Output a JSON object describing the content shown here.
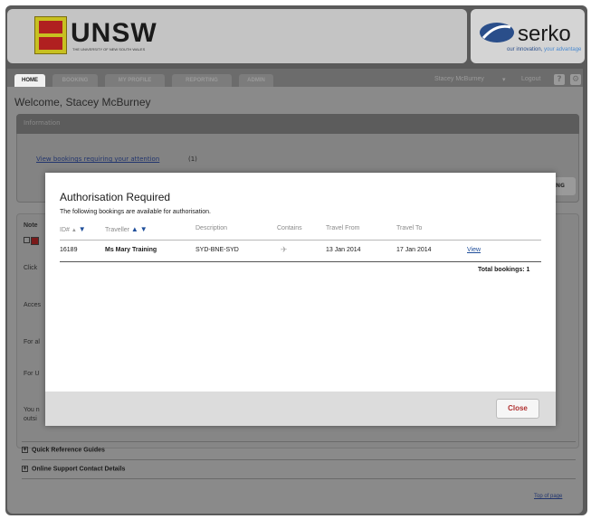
{
  "header": {
    "logo_text": "UNSW",
    "logo_subtitle": "THE UNIVERSITY OF NEW SOUTH WALES",
    "partner_logo": "serko",
    "partner_tagline_a": "our innovation, ",
    "partner_tagline_b": "your advantage"
  },
  "nav": {
    "tabs": [
      {
        "label": "HOME"
      },
      {
        "label": "BOOKING"
      },
      {
        "label": "MY PROFILE"
      },
      {
        "label": "REPORTING"
      },
      {
        "label": "ADMIN"
      }
    ],
    "user_name": "Stacey McBurney",
    "dropdown": "▾",
    "logout": "Logout",
    "help_icon": "?",
    "settings_icon": "gear-icon"
  },
  "page": {
    "welcome": "Welcome, Stacey McBurney",
    "info_heading": "Information",
    "info_link": "View bookings requiring your attention",
    "info_count": "(1)",
    "peek_button": "NG",
    "notes_label": "Note",
    "side_texts": [
      "Click",
      "Acces",
      "For al",
      "For U",
      "You n",
      "outsi"
    ],
    "accordion": [
      {
        "label": "Quick Reference Guides"
      },
      {
        "label": "Online Support Contact Details"
      }
    ],
    "top_link": "Top of page"
  },
  "modal": {
    "title": "Authorisation Required",
    "subtitle": "The following bookings are available for authorisation.",
    "columns": {
      "id": "ID#",
      "traveller": "Traveller",
      "description": "Description",
      "contains": "Contains",
      "travel_from": "Travel From",
      "travel_to": "Travel To"
    },
    "row": {
      "id": "16189",
      "traveller": "Ms Mary Training",
      "description": "SYD-BNE-SYD",
      "contains_icon": "plane-icon",
      "travel_from": "13 Jan 2014",
      "travel_to": "17 Jan 2014",
      "action": "View"
    },
    "total_label": "Total bookings: 1",
    "close_label": "Close"
  },
  "colors": {
    "link_blue": "#1f4e9a",
    "close_red": "#b03030",
    "overlay_gray": "#8a8a8a"
  }
}
